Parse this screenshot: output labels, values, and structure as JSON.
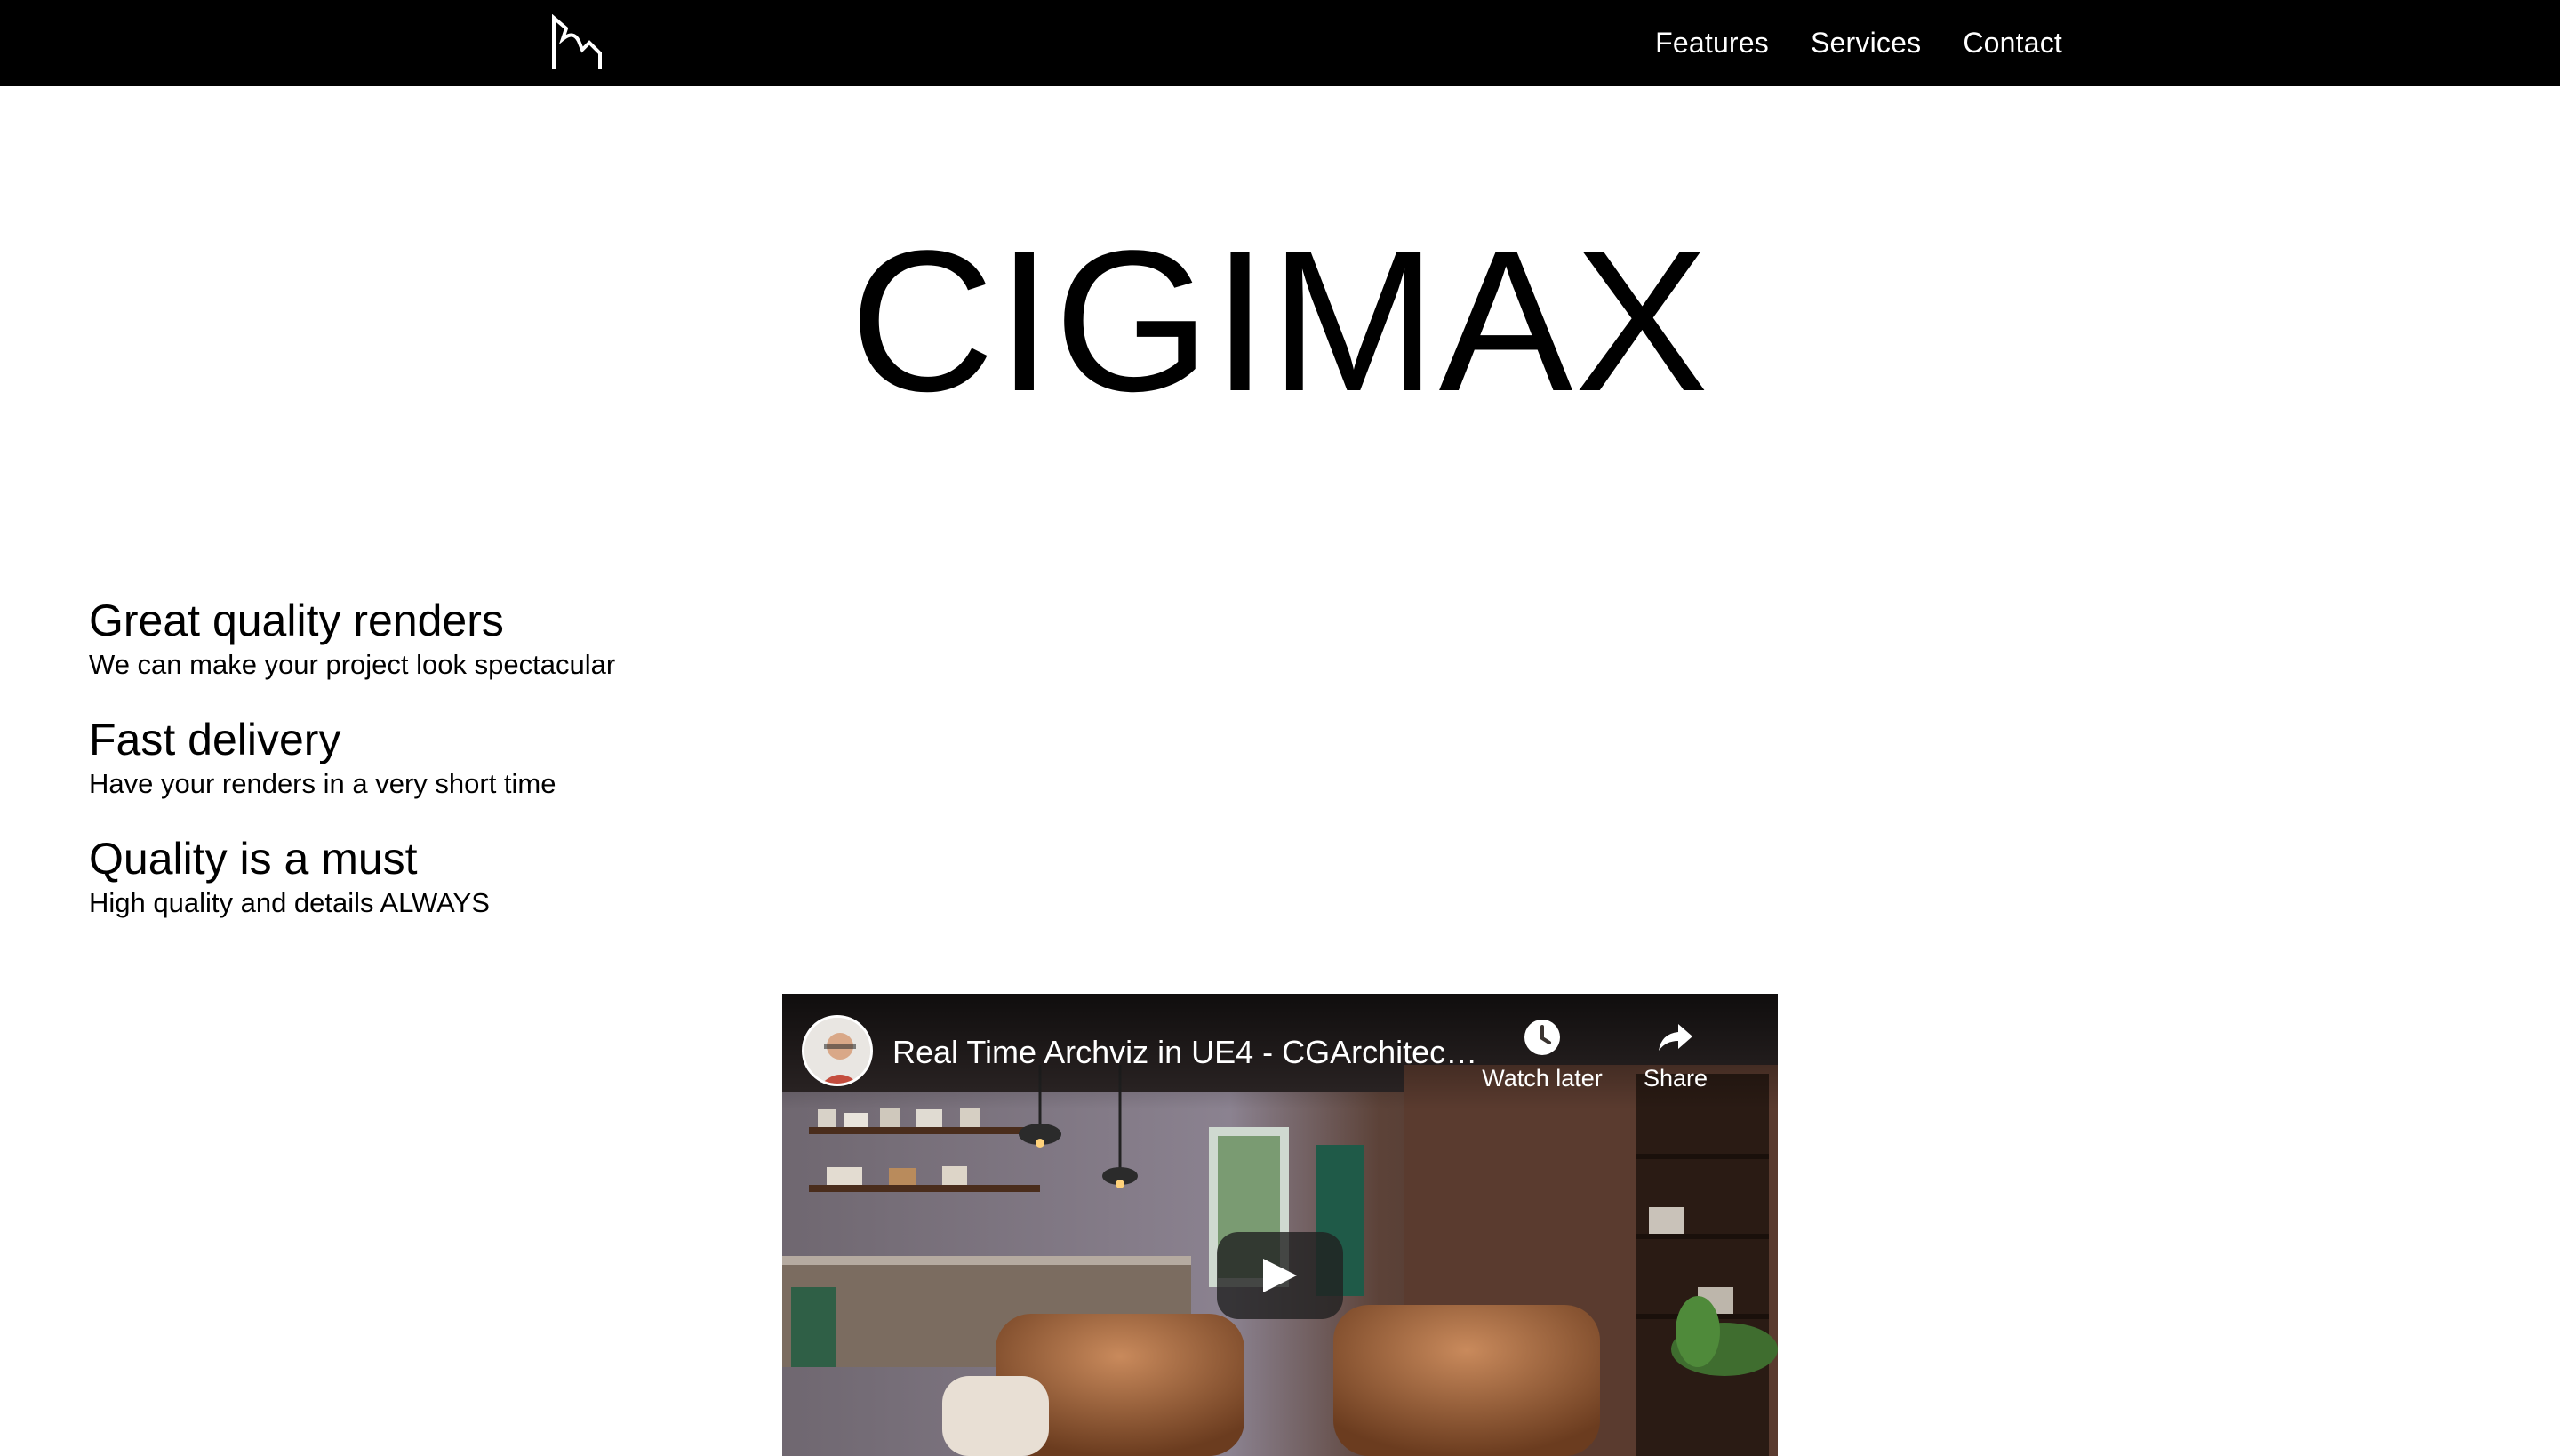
{
  "nav": {
    "logo_icon": "cigimax-logo-icon",
    "links": [
      "Features",
      "Services",
      "Contact"
    ]
  },
  "hero": {
    "title": "CIGIMAX"
  },
  "features": [
    {
      "title": "Great quality renders",
      "description": "We can make your project look spectacular"
    },
    {
      "title": "Fast delivery",
      "description": "Have your renders in a very short time"
    },
    {
      "title": "Quality is a must",
      "description": "High quality and details ALWAYS"
    }
  ],
  "video": {
    "title": "Real Time Archviz in UE4 - CGArchitect A...",
    "watch_later_label": "Watch later",
    "share_label": "Share",
    "watch_later_icon": "clock-icon",
    "share_icon": "share-icon",
    "play_icon": "play-icon"
  },
  "colors": {
    "navbar_bg": "#000000",
    "nav_text": "#ffffff",
    "page_bg": "#ffffff",
    "text": "#000000"
  }
}
